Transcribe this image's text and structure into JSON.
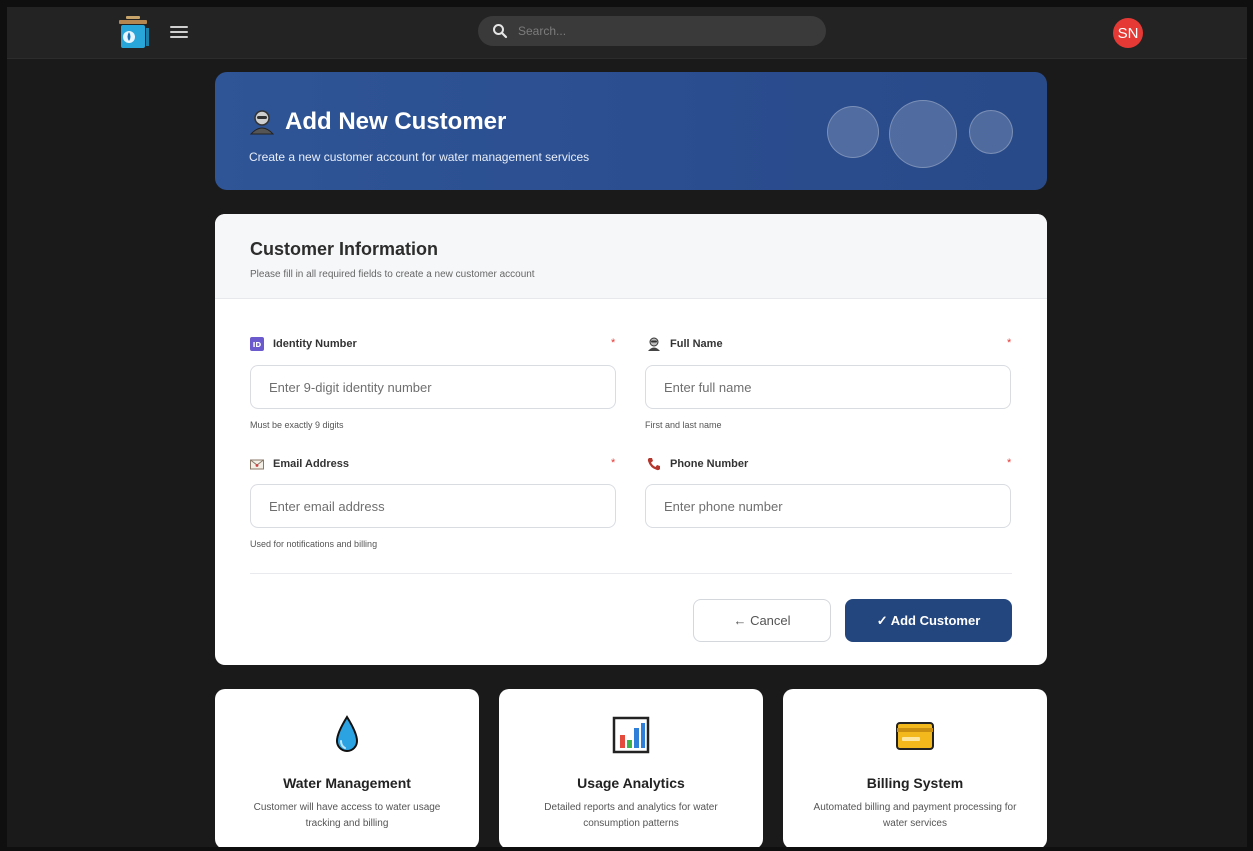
{
  "topbar": {
    "search_placeholder": "Search...",
    "avatar_initials": "SN",
    "avatar_color": "#e53935"
  },
  "hero": {
    "title": "Add New Customer",
    "subtitle": "Create a new customer account for water management services",
    "icon": "person-icon"
  },
  "form": {
    "title": "Customer Information",
    "subtitle": "Please fill in all required fields to create a new customer account",
    "fields": [
      {
        "label": "Identity Number",
        "placeholder": "Enter 9-digit identity number",
        "hint": "Must be exactly 9 digits",
        "required_mark": "*",
        "icon": "id-badge-icon"
      },
      {
        "label": "Full Name",
        "placeholder": "Enter full name",
        "hint": "First and last name",
        "required_mark": "*",
        "icon": "person-icon"
      },
      {
        "label": "Email Address",
        "placeholder": "Enter email address",
        "hint": "Used for notifications and billing",
        "required_mark": "*",
        "icon": "envelope-icon"
      },
      {
        "label": "Phone Number",
        "placeholder": "Enter phone number",
        "hint": "",
        "required_mark": "*",
        "icon": "phone-icon"
      }
    ],
    "cancel_label": "← Cancel",
    "submit_label": "✓ Add Customer",
    "primary_color": "#24467f"
  },
  "features": [
    {
      "title": "Water Management",
      "description": "Customer will have access to water usage tracking and billing",
      "icon": "water-drop-icon"
    },
    {
      "title": "Usage Analytics",
      "description": "Detailed reports and analytics for water consumption patterns",
      "icon": "bar-chart-icon"
    },
    {
      "title": "Billing System",
      "description": "Automated billing and payment processing for water services",
      "icon": "credit-card-icon"
    }
  ]
}
